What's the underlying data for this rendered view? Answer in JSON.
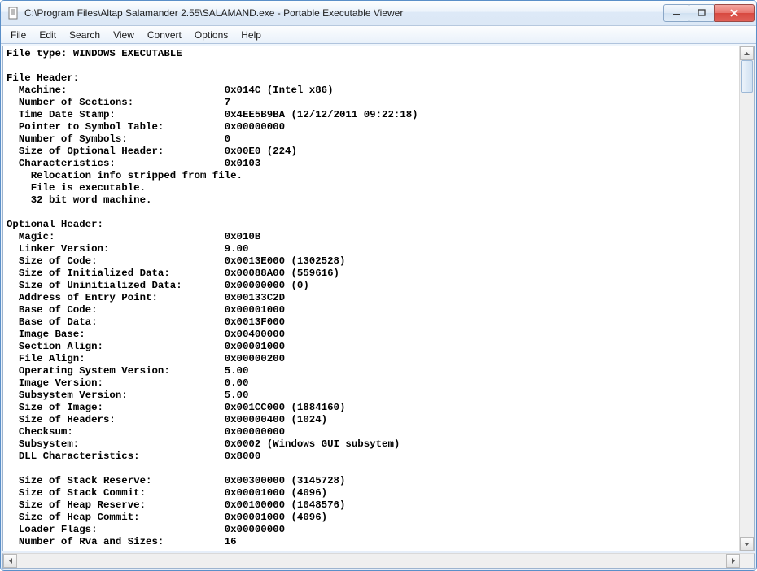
{
  "window": {
    "title": "C:\\Program Files\\Altap Salamander 2.55\\SALAMAND.exe - Portable Executable Viewer"
  },
  "menu": {
    "items": [
      "File",
      "Edit",
      "Search",
      "View",
      "Convert",
      "Options",
      "Help"
    ]
  },
  "content": {
    "fileTypeLabel": "File type:",
    "fileType": "WINDOWS EXECUTABLE",
    "fileHeader": {
      "title": "File Header:",
      "rows": [
        {
          "label": "Machine:",
          "value": "0x014C (Intel x86)"
        },
        {
          "label": "Number of Sections:",
          "value": "7"
        },
        {
          "label": "Time Date Stamp:",
          "value": "0x4EE5B9BA (12/12/2011 09:22:18)"
        },
        {
          "label": "Pointer to Symbol Table:",
          "value": "0x00000000"
        },
        {
          "label": "Number of Symbols:",
          "value": "0"
        },
        {
          "label": "Size of Optional Header:",
          "value": "0x00E0 (224)"
        },
        {
          "label": "Characteristics:",
          "value": "0x0103"
        }
      ],
      "characteristics": [
        "Relocation info stripped from file.",
        "File is executable.",
        "32 bit word machine."
      ]
    },
    "optionalHeader": {
      "title": "Optional Header:",
      "group1": [
        {
          "label": "Magic:",
          "value": "0x010B"
        },
        {
          "label": "Linker Version:",
          "value": "9.00"
        },
        {
          "label": "Size of Code:",
          "value": "0x0013E000 (1302528)"
        },
        {
          "label": "Size of Initialized Data:",
          "value": "0x00088A00 (559616)"
        },
        {
          "label": "Size of Uninitialized Data:",
          "value": "0x00000000 (0)"
        },
        {
          "label": "Address of Entry Point:",
          "value": "0x00133C2D"
        },
        {
          "label": "Base of Code:",
          "value": "0x00001000"
        },
        {
          "label": "Base of Data:",
          "value": "0x0013F000"
        },
        {
          "label": "Image Base:",
          "value": "0x00400000"
        },
        {
          "label": "Section Align:",
          "value": "0x00001000"
        },
        {
          "label": "File Align:",
          "value": "0x00000200"
        },
        {
          "label": "Operating System Version:",
          "value": "5.00"
        },
        {
          "label": "Image Version:",
          "value": "0.00"
        },
        {
          "label": "Subsystem Version:",
          "value": "5.00"
        },
        {
          "label": "Size of Image:",
          "value": "0x001CC000 (1884160)"
        },
        {
          "label": "Size of Headers:",
          "value": "0x00000400 (1024)"
        },
        {
          "label": "Checksum:",
          "value": "0x00000000"
        },
        {
          "label": "Subsystem:",
          "value": "0x0002 (Windows GUI subsytem)"
        },
        {
          "label": "DLL Characteristics:",
          "value": "0x8000"
        }
      ],
      "group2": [
        {
          "label": "Size of Stack Reserve:",
          "value": "0x00300000 (3145728)"
        },
        {
          "label": "Size of Stack Commit:",
          "value": "0x00001000 (4096)"
        },
        {
          "label": "Size of Heap Reserve:",
          "value": "0x00100000 (1048576)"
        },
        {
          "label": "Size of Heap Commit:",
          "value": "0x00001000 (4096)"
        },
        {
          "label": "Loader Flags:",
          "value": "0x00000000"
        },
        {
          "label": "Number of Rva and Sizes:",
          "value": "16"
        }
      ]
    }
  }
}
